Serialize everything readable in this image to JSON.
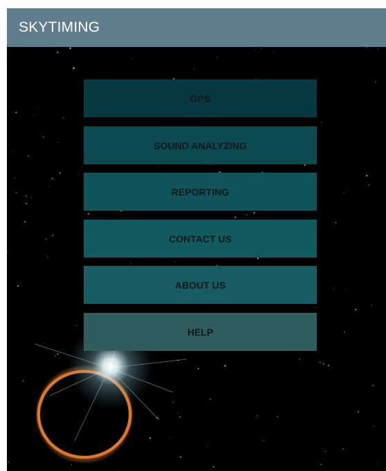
{
  "app": {
    "title": "SKYTIMING"
  },
  "menu": {
    "items": [
      {
        "label": "GPS",
        "color": "#063a40"
      },
      {
        "label": "SOUND ANALYZING",
        "color": "#0c4a51"
      },
      {
        "label": "REPORTING",
        "color": "#0e545a"
      },
      {
        "label": "CONTACT US",
        "color": "#115a60"
      },
      {
        "label": "ABOUT US",
        "color": "#165c62"
      },
      {
        "label": "HELP",
        "color": "#2f5d5e"
      }
    ]
  },
  "colors": {
    "action_bar": "#607d8b",
    "background": "#000000",
    "eclipse_ring": "#e0742a"
  }
}
